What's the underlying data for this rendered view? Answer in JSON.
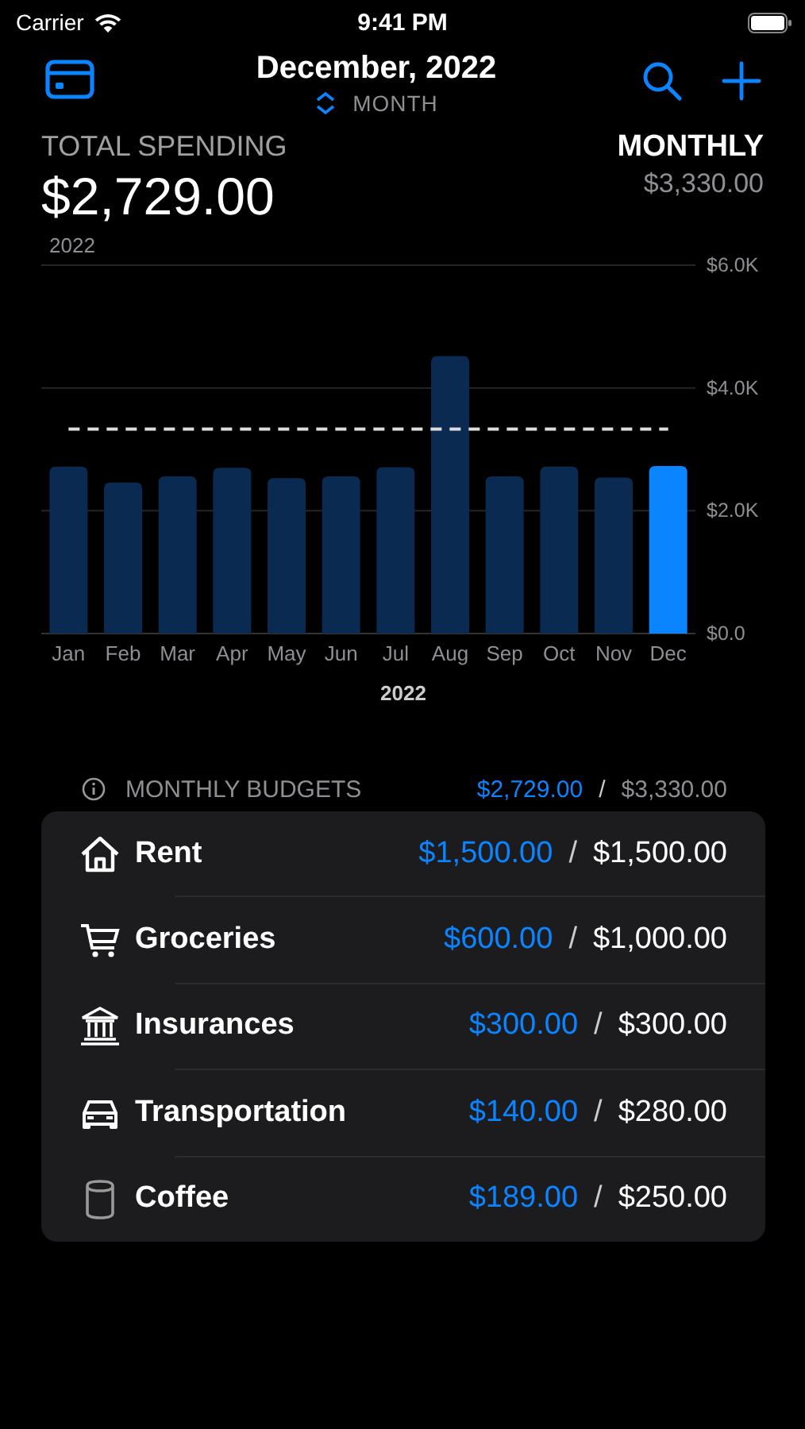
{
  "status_bar": {
    "carrier": "Carrier",
    "time": "9:41 PM"
  },
  "nav": {
    "title": "December, 2022",
    "period": "MONTH"
  },
  "summary": {
    "label": "TOTAL SPENDING",
    "amount": "$2,729.00",
    "year": "2022",
    "budget_label": "MONTHLY",
    "budget_amount": "$3,330.00"
  },
  "chart": {
    "chart_data": {
      "type": "bar",
      "xlabel": "2022",
      "categories": [
        "Jan",
        "Feb",
        "Mar",
        "Apr",
        "May",
        "Jun",
        "Jul",
        "Aug",
        "Sep",
        "Oct",
        "Nov",
        "Dec"
      ],
      "series": [
        {
          "color": "#0a2a52",
          "values": [
            2720,
            2460,
            2560,
            2700,
            2530,
            2560,
            2710,
            4520,
            2560,
            2720,
            2540,
            null
          ]
        },
        {
          "color": "#0a84ff",
          "values": [
            null,
            null,
            null,
            null,
            null,
            null,
            null,
            null,
            null,
            null,
            null,
            2730
          ]
        },
        {
          "type": "line",
          "color": "#dddddd",
          "line_style": "dashed",
          "values": [
            3330,
            3330,
            3330,
            3330,
            3330,
            3330,
            3330,
            3330,
            3330,
            3330,
            3330,
            3330
          ]
        }
      ],
      "ylim": [
        0,
        6000
      ],
      "yticks": [
        {
          "value": 0,
          "label": "$0.0"
        },
        {
          "value": 2000,
          "label": "$2.0K"
        },
        {
          "value": 4000,
          "label": "$4.0K"
        },
        {
          "value": 6000,
          "label": "$6.0K"
        }
      ]
    }
  },
  "budgets": {
    "title": "MONTHLY BUDGETS",
    "spent": "$2,729.00",
    "separator": "/",
    "total": "$3,330.00",
    "items": [
      {
        "kind": "house",
        "name": "Rent",
        "spent": "$1,500.00",
        "total": "$1,500.00"
      },
      {
        "kind": "cart",
        "name": "Groceries",
        "spent": "$600.00",
        "total": "$1,000.00"
      },
      {
        "kind": "bank",
        "name": "Insurances",
        "spent": "$300.00",
        "total": "$300.00"
      },
      {
        "kind": "car",
        "name": "Transportation",
        "spent": "$140.00",
        "total": "$280.00"
      },
      {
        "kind": "cup",
        "name": "Coffee",
        "spent": "$189.00",
        "total": "$250.00"
      }
    ]
  }
}
